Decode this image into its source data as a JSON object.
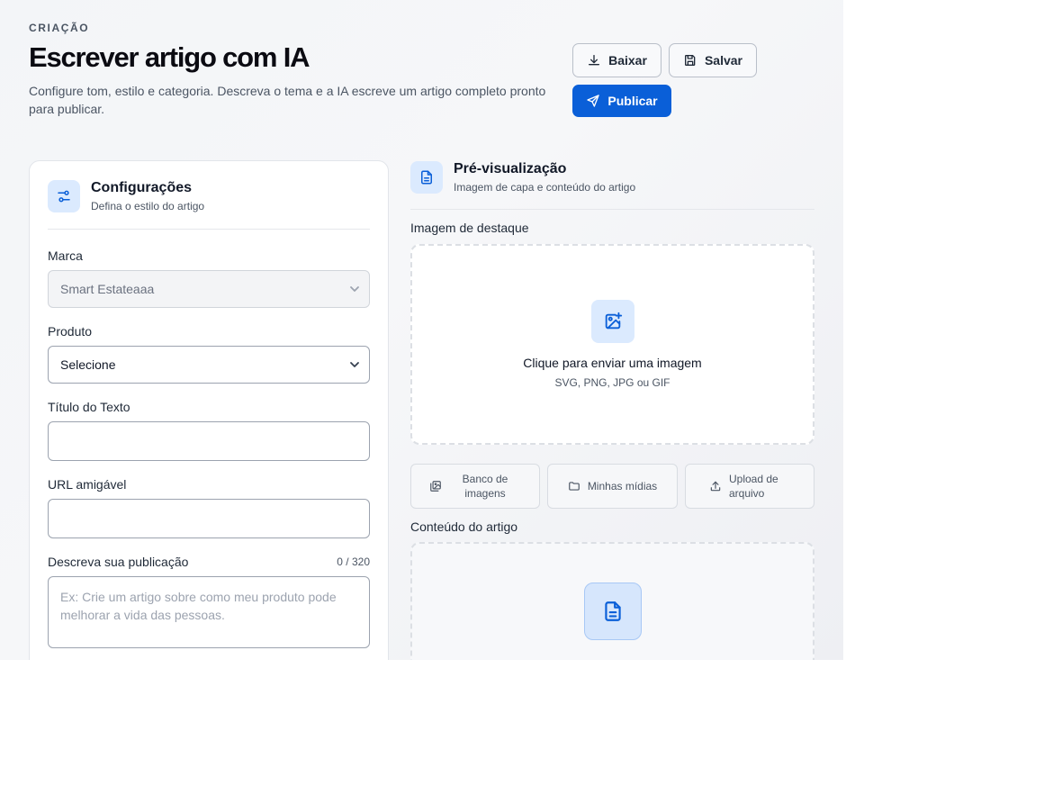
{
  "header": {
    "eyebrow": "CRIAÇÃO",
    "title": "Escrever artigo com IA",
    "subtitle": "Configure tom, estilo e categoria. Descreva o tema e a IA escreve um artigo completo pronto para publicar."
  },
  "actions": {
    "download_label": "Baixar",
    "save_label": "Salvar",
    "publish_label": "Publicar"
  },
  "settings": {
    "title": "Configurações",
    "subtitle": "Defina o estilo do artigo",
    "brand": {
      "label": "Marca",
      "value": "Smart Estateaaa"
    },
    "product": {
      "label": "Produto",
      "value": "Selecione"
    },
    "text_title": {
      "label": "Título do Texto",
      "value": ""
    },
    "friendly_url": {
      "label": "URL amigável",
      "value": ""
    },
    "description": {
      "label": "Descreva sua publicação",
      "counter": "0 / 320",
      "placeholder": "Ex: Crie um artigo sobre como meu produto pode melhorar a vida das pessoas."
    }
  },
  "preview": {
    "title": "Pré-visualização",
    "subtitle": "Imagem de capa e conteúdo do artigo",
    "featured_image": {
      "label": "Imagem de destaque",
      "upload_title": "Clique para enviar uma imagem",
      "upload_hint": "SVG, PNG, JPG ou GIF"
    },
    "media_buttons": [
      "Banco de imagens",
      "Minhas mídias",
      "Upload de arquivo"
    ],
    "content_label": "Conteúdo do artigo"
  },
  "icons": {
    "download": "download-icon",
    "save": "save-icon",
    "publish": "send-icon",
    "settings": "sliders-icon",
    "preview": "document-icon",
    "upload_image": "image-plus-icon",
    "image_bank": "images-icon",
    "my_media": "folder-icon",
    "upload_file": "upload-icon",
    "content": "document-icon"
  },
  "colors": {
    "primary": "#0a5fd8",
    "icon_tile": "#dbeafe",
    "accent_icon": "#0a5fd8"
  }
}
